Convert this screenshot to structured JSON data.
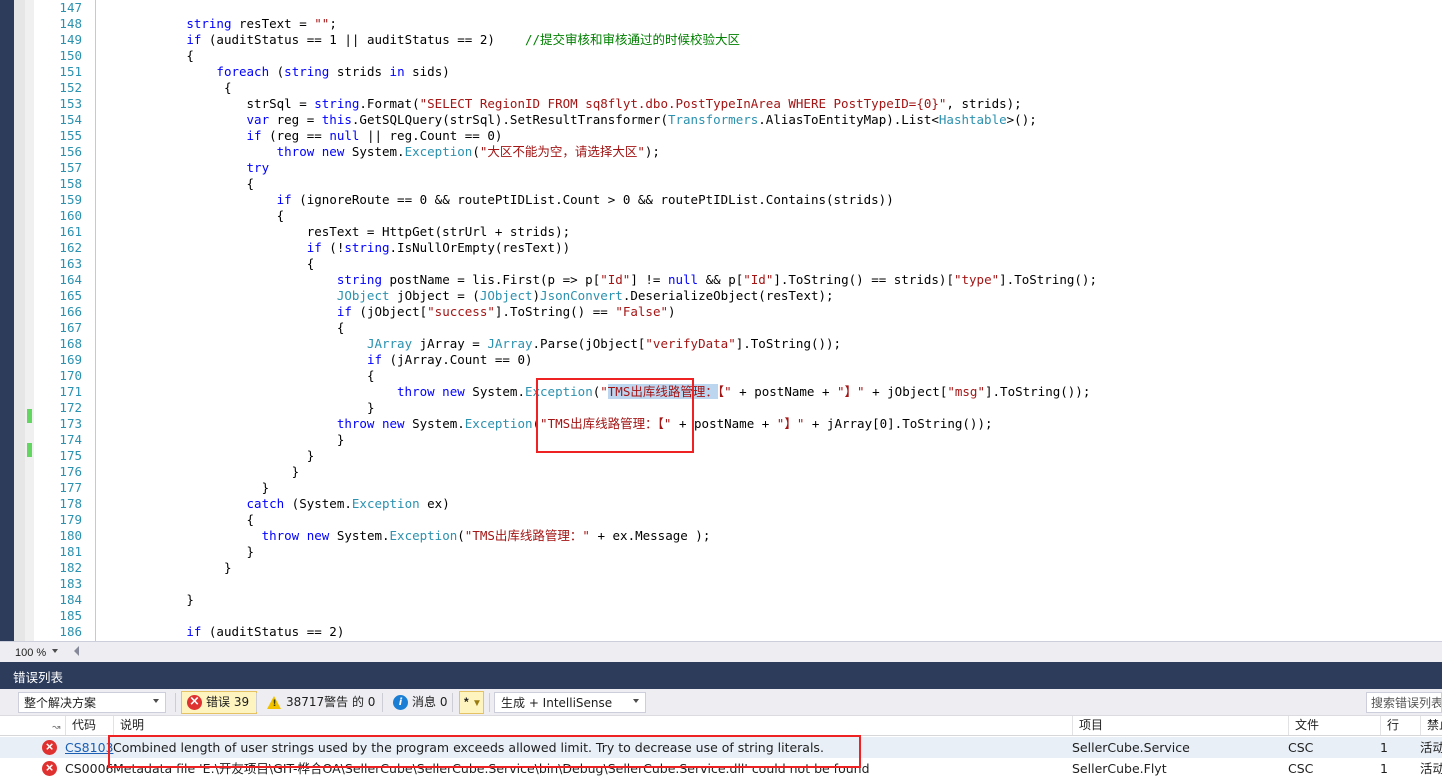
{
  "editor": {
    "zoom_level": "100 %",
    "first_line": 147,
    "lines": [
      {
        "n": 147,
        "changed": false,
        "indent": 0,
        "tokens": []
      },
      {
        "n": 148,
        "changed": false,
        "indent": 12,
        "tokens": [
          {
            "t": "string ",
            "c": "kw"
          },
          {
            "t": "resText = ",
            "c": "pln"
          },
          {
            "t": "\"\"",
            "c": "str"
          },
          {
            "t": ";",
            "c": "pln"
          }
        ]
      },
      {
        "n": 149,
        "changed": false,
        "indent": 12,
        "tokens": [
          {
            "t": "if",
            "c": "kw"
          },
          {
            "t": " (auditStatus == 1 || auditStatus == 2)    ",
            "c": "pln"
          },
          {
            "t": "//提交审核和审核通过的时候校验大区",
            "c": "cmt"
          }
        ]
      },
      {
        "n": 150,
        "changed": false,
        "indent": 12,
        "tokens": [
          {
            "t": "{",
            "c": "pln"
          }
        ]
      },
      {
        "n": 151,
        "changed": false,
        "indent": 16,
        "tokens": [
          {
            "t": "foreach",
            "c": "kw"
          },
          {
            "t": " (",
            "c": "pln"
          },
          {
            "t": "string",
            "c": "kw"
          },
          {
            "t": " strids ",
            "c": "pln"
          },
          {
            "t": "in",
            "c": "kw"
          },
          {
            "t": " sids)",
            "c": "pln"
          }
        ]
      },
      {
        "n": 152,
        "changed": false,
        "indent": 17,
        "tokens": [
          {
            "t": "{",
            "c": "pln"
          }
        ]
      },
      {
        "n": 153,
        "changed": false,
        "indent": 20,
        "tokens": [
          {
            "t": "strSql = ",
            "c": "pln"
          },
          {
            "t": "string",
            "c": "kw"
          },
          {
            "t": ".Format(",
            "c": "pln"
          },
          {
            "t": "\"SELECT RegionID FROM sq8flyt.dbo.PostTypeInArea WHERE PostTypeID={0}\"",
            "c": "str"
          },
          {
            "t": ", strids);",
            "c": "pln"
          }
        ]
      },
      {
        "n": 154,
        "changed": false,
        "indent": 20,
        "tokens": [
          {
            "t": "var",
            "c": "kw"
          },
          {
            "t": " reg = ",
            "c": "pln"
          },
          {
            "t": "this",
            "c": "kw"
          },
          {
            "t": ".GetSQLQuery(strSql).SetResultTransformer(",
            "c": "pln"
          },
          {
            "t": "Transformers",
            "c": "typ"
          },
          {
            "t": ".AliasToEntityMap).List<",
            "c": "pln"
          },
          {
            "t": "Hashtable",
            "c": "typ"
          },
          {
            "t": ">();",
            "c": "pln"
          }
        ]
      },
      {
        "n": 155,
        "changed": false,
        "indent": 20,
        "tokens": [
          {
            "t": "if",
            "c": "kw"
          },
          {
            "t": " (reg == ",
            "c": "pln"
          },
          {
            "t": "null",
            "c": "kw"
          },
          {
            "t": " || reg.Count == 0)",
            "c": "pln"
          }
        ]
      },
      {
        "n": 156,
        "changed": false,
        "indent": 24,
        "tokens": [
          {
            "t": "throw new",
            "c": "kw"
          },
          {
            "t": " System.",
            "c": "pln"
          },
          {
            "t": "Exception",
            "c": "typ"
          },
          {
            "t": "(",
            "c": "pln"
          },
          {
            "t": "\"大区不能为空，请选择大区\"",
            "c": "str"
          },
          {
            "t": ");",
            "c": "pln"
          }
        ]
      },
      {
        "n": 157,
        "changed": false,
        "indent": 20,
        "tokens": [
          {
            "t": "try",
            "c": "kw"
          }
        ]
      },
      {
        "n": 158,
        "changed": false,
        "indent": 20,
        "tokens": [
          {
            "t": "{",
            "c": "pln"
          }
        ]
      },
      {
        "n": 159,
        "changed": false,
        "indent": 24,
        "tokens": [
          {
            "t": "if",
            "c": "kw"
          },
          {
            "t": " (ignoreRoute == 0 && routePtIDList.Count > 0 && routePtIDList.Contains(strids))",
            "c": "pln"
          }
        ]
      },
      {
        "n": 160,
        "changed": false,
        "indent": 24,
        "tokens": [
          {
            "t": "{",
            "c": "pln"
          }
        ]
      },
      {
        "n": 161,
        "changed": false,
        "indent": 28,
        "tokens": [
          {
            "t": "resText = HttpGet(strUrl + strids);",
            "c": "pln"
          }
        ]
      },
      {
        "n": 162,
        "changed": false,
        "indent": 28,
        "tokens": [
          {
            "t": "if",
            "c": "kw"
          },
          {
            "t": " (!",
            "c": "pln"
          },
          {
            "t": "string",
            "c": "kw"
          },
          {
            "t": ".IsNullOrEmpty(resText))",
            "c": "pln"
          }
        ]
      },
      {
        "n": 163,
        "changed": false,
        "indent": 28,
        "tokens": [
          {
            "t": "{",
            "c": "pln"
          }
        ]
      },
      {
        "n": 164,
        "changed": false,
        "indent": 32,
        "tokens": [
          {
            "t": "string",
            "c": "kw"
          },
          {
            "t": " postName = lis.First(p => p[",
            "c": "pln"
          },
          {
            "t": "\"Id\"",
            "c": "str"
          },
          {
            "t": "] != ",
            "c": "pln"
          },
          {
            "t": "null",
            "c": "kw"
          },
          {
            "t": " && p[",
            "c": "pln"
          },
          {
            "t": "\"Id\"",
            "c": "str"
          },
          {
            "t": "].ToString() == strids)[",
            "c": "pln"
          },
          {
            "t": "\"type\"",
            "c": "str"
          },
          {
            "t": "].ToString();",
            "c": "pln"
          }
        ]
      },
      {
        "n": 165,
        "changed": false,
        "indent": 32,
        "tokens": [
          {
            "t": "JObject",
            "c": "typ"
          },
          {
            "t": " jObject = (",
            "c": "pln"
          },
          {
            "t": "JObject",
            "c": "typ"
          },
          {
            "t": ")",
            "c": "pln"
          },
          {
            "t": "JsonConvert",
            "c": "typ"
          },
          {
            "t": ".DeserializeObject(resText);",
            "c": "pln"
          }
        ]
      },
      {
        "n": 166,
        "changed": false,
        "indent": 32,
        "tokens": [
          {
            "t": "if",
            "c": "kw"
          },
          {
            "t": " (jObject[",
            "c": "pln"
          },
          {
            "t": "\"success\"",
            "c": "str"
          },
          {
            "t": "].ToString() == ",
            "c": "pln"
          },
          {
            "t": "\"False\"",
            "c": "str"
          },
          {
            "t": ")",
            "c": "pln"
          }
        ]
      },
      {
        "n": 167,
        "changed": false,
        "indent": 32,
        "tokens": [
          {
            "t": "{",
            "c": "pln"
          }
        ]
      },
      {
        "n": 168,
        "changed": false,
        "indent": 36,
        "tokens": [
          {
            "t": "JArray",
            "c": "typ"
          },
          {
            "t": " jArray = ",
            "c": "pln"
          },
          {
            "t": "JArray",
            "c": "typ"
          },
          {
            "t": ".Parse(jObject[",
            "c": "pln"
          },
          {
            "t": "\"verifyData\"",
            "c": "str"
          },
          {
            "t": "].ToString());",
            "c": "pln"
          }
        ]
      },
      {
        "n": 169,
        "changed": false,
        "indent": 36,
        "tokens": [
          {
            "t": "if",
            "c": "kw"
          },
          {
            "t": " (jArray.Count == 0)",
            "c": "pln"
          }
        ]
      },
      {
        "n": 170,
        "changed": false,
        "indent": 36,
        "tokens": [
          {
            "t": "{",
            "c": "pln"
          }
        ]
      },
      {
        "n": 171,
        "changed": true,
        "indent": 40,
        "tokens": [
          {
            "t": "throw new",
            "c": "kw"
          },
          {
            "t": " System.",
            "c": "pln"
          },
          {
            "t": "Exception",
            "c": "typ"
          },
          {
            "t": "(",
            "c": "pln"
          },
          {
            "t": "\"",
            "c": "str"
          },
          {
            "t": "TMS出库线路管理：",
            "c": "str sel"
          },
          {
            "t": "【\"",
            "c": "str"
          },
          {
            "t": " + postName + ",
            "c": "pln"
          },
          {
            "t": "\"】\"",
            "c": "str"
          },
          {
            "t": " + jObject[",
            "c": "pln"
          },
          {
            "t": "\"msg\"",
            "c": "str"
          },
          {
            "t": "].ToString());",
            "c": "pln"
          }
        ]
      },
      {
        "n": 172,
        "changed": false,
        "indent": 36,
        "tokens": [
          {
            "t": "}",
            "c": "pln"
          }
        ]
      },
      {
        "n": 173,
        "changed": true,
        "indent": 32,
        "tokens": [
          {
            "t": "throw new",
            "c": "kw"
          },
          {
            "t": " System.",
            "c": "pln"
          },
          {
            "t": "Exception",
            "c": "typ"
          },
          {
            "t": "(",
            "c": "pln"
          },
          {
            "t": "\"TMS出库线路管理：【\"",
            "c": "str"
          },
          {
            "t": " + postName + ",
            "c": "pln"
          },
          {
            "t": "\"】\"",
            "c": "str"
          },
          {
            "t": " + jArray[0].ToString());",
            "c": "pln"
          }
        ]
      },
      {
        "n": 174,
        "changed": false,
        "indent": 32,
        "tokens": [
          {
            "t": "}",
            "c": "pln"
          }
        ]
      },
      {
        "n": 175,
        "changed": false,
        "indent": 28,
        "tokens": [
          {
            "t": "}",
            "c": "pln"
          }
        ]
      },
      {
        "n": 176,
        "changed": false,
        "indent": 26,
        "tokens": [
          {
            "t": "}",
            "c": "pln"
          }
        ]
      },
      {
        "n": 177,
        "changed": false,
        "indent": 22,
        "tokens": [
          {
            "t": "}",
            "c": "pln"
          }
        ]
      },
      {
        "n": 178,
        "changed": false,
        "indent": 20,
        "tokens": [
          {
            "t": "catch",
            "c": "kw"
          },
          {
            "t": " (System.",
            "c": "pln"
          },
          {
            "t": "Exception",
            "c": "typ"
          },
          {
            "t": " ex)",
            "c": "pln"
          }
        ]
      },
      {
        "n": 179,
        "changed": false,
        "indent": 20,
        "tokens": [
          {
            "t": "{",
            "c": "pln"
          }
        ]
      },
      {
        "n": 180,
        "changed": false,
        "indent": 22,
        "tokens": [
          {
            "t": "throw new",
            "c": "kw"
          },
          {
            "t": " System.",
            "c": "pln"
          },
          {
            "t": "Exception",
            "c": "typ"
          },
          {
            "t": "(",
            "c": "pln"
          },
          {
            "t": "\"TMS出库线路管理：\"",
            "c": "str"
          },
          {
            "t": " + ex.Message );",
            "c": "pln"
          }
        ]
      },
      {
        "n": 181,
        "changed": false,
        "indent": 20,
        "tokens": [
          {
            "t": "}",
            "c": "pln"
          }
        ]
      },
      {
        "n": 182,
        "changed": false,
        "indent": 17,
        "tokens": [
          {
            "t": "}",
            "c": "pln"
          }
        ]
      },
      {
        "n": 183,
        "changed": false,
        "indent": 0,
        "tokens": []
      },
      {
        "n": 184,
        "changed": false,
        "indent": 12,
        "tokens": [
          {
            "t": "}",
            "c": "pln"
          }
        ]
      },
      {
        "n": 185,
        "changed": false,
        "indent": 0,
        "tokens": []
      },
      {
        "n": 186,
        "changed": false,
        "indent": 12,
        "tokens": [
          {
            "t": "if",
            "c": "kw"
          },
          {
            "t": " (auditStatus == 2)",
            "c": "pln"
          }
        ]
      }
    ]
  },
  "error_list": {
    "title": "错误列表",
    "scope_filter": "整个解决方案",
    "errors_label": "错误 39",
    "warnings_label": "38717警告 的 0",
    "messages_label": "消息 0",
    "build_filter": "生成 + IntelliSense",
    "search_placeholder": "搜索错误列表",
    "columns": {
      "code": "代码",
      "description": "说明",
      "project": "项目",
      "file": "文件",
      "line": "行",
      "suppression": "禁止"
    },
    "rows": [
      {
        "severity": "error",
        "code": "CS8103",
        "description": "Combined length of user strings used by the program exceeds allowed limit. Try to decrease use of string literals.",
        "project": "SellerCube.Service",
        "file": "CSC",
        "line": "1",
        "suppression": "活动",
        "selected": true,
        "code_is_link": true
      },
      {
        "severity": "error",
        "code": "CS0006",
        "description": "Metadata file 'E:\\开友项目\\GIT-桦合OA\\SellerCube\\SellerCube.Service\\bin\\Debug\\SellerCube.Service.dll' could not be found",
        "project": "SellerCube.Flyt",
        "file": "CSC",
        "line": "1",
        "suppression": "活动",
        "selected": false,
        "code_is_link": false
      }
    ]
  },
  "colors": {
    "chrome_dark": "#2d3c5b",
    "toolbar_bg": "#eeeef2",
    "keyword": "#0000ff",
    "type": "#2b91af",
    "string": "#a31515",
    "comment": "#008000",
    "selection": "#bcd6f0",
    "change_marker": "#62d661",
    "annotation_red": "#ee2222",
    "error_red": "#e03131",
    "warning_yellow": "#f2c200",
    "info_blue": "#1a7fd4",
    "link_blue": "#1a5fb4",
    "row_selected": "#e8eff7"
  }
}
